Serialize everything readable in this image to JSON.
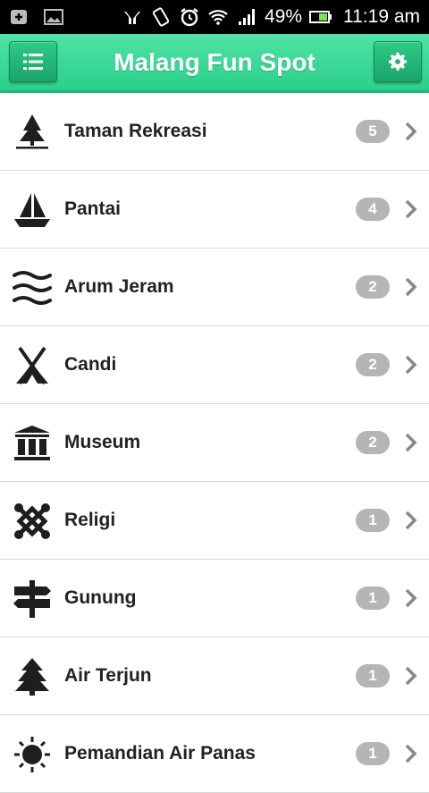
{
  "status_bar": {
    "battery": "49%",
    "time": "11:19 am",
    "icons": [
      "add-box-icon",
      "image-icon",
      "hands-icon",
      "rotate-icon",
      "alarm-icon",
      "wifi-icon",
      "signal-icon",
      "battery-icon"
    ]
  },
  "app_bar": {
    "title": "Malang Fun Spot",
    "menu_icon": "list-menu-icon",
    "settings_icon": "gear-icon",
    "accent_color": "#2bcf8b"
  },
  "categories": [
    {
      "label": "Taman Rekreasi",
      "count": "5",
      "icon": "tree-icon"
    },
    {
      "label": "Pantai",
      "count": "4",
      "icon": "sailboat-icon"
    },
    {
      "label": "Arum Jeram",
      "count": "2",
      "icon": "waves-icon"
    },
    {
      "label": "Candi",
      "count": "2",
      "icon": "tent-icon"
    },
    {
      "label": "Museum",
      "count": "2",
      "icon": "museum-icon"
    },
    {
      "label": "Religi",
      "count": "1",
      "icon": "knot-icon"
    },
    {
      "label": "Gunung",
      "count": "1",
      "icon": "signpost-icon"
    },
    {
      "label": "Air Terjun",
      "count": "1",
      "icon": "pine-tree-icon"
    },
    {
      "label": "Pemandian Air Panas",
      "count": "1",
      "icon": "sun-icon"
    }
  ]
}
